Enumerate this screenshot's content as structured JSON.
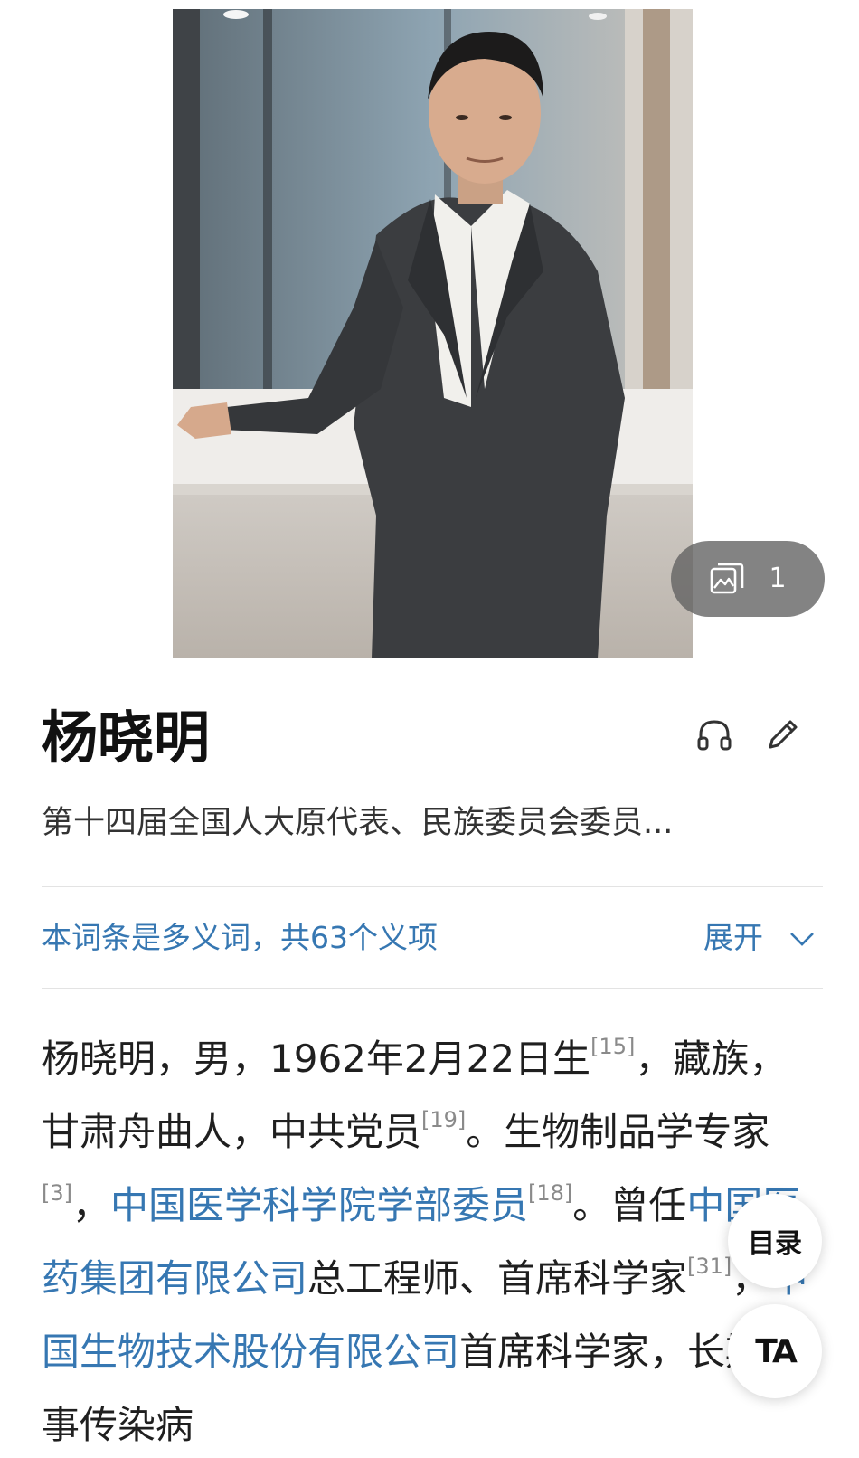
{
  "photo": {
    "gallery_count": "1",
    "gallery_icon": "image-gallery-icon"
  },
  "header": {
    "title": "杨晓明",
    "subtitle": "第十四届全国人大原代表、民族委员会委员...",
    "actions": [
      "headphones-icon",
      "pencil-icon"
    ]
  },
  "polysemy": {
    "note": "本词条是多义词，共63个义项",
    "expand_label": "展开",
    "expand_icon": "chevron-down-icon"
  },
  "body": {
    "segments": [
      {
        "type": "text",
        "text": "杨晓明，男，1962年2月22日生"
      },
      {
        "type": "ref",
        "text": "[15]"
      },
      {
        "type": "text",
        "text": "，藏族，甘肃舟曲人，中共党员"
      },
      {
        "type": "ref",
        "text": "[19]"
      },
      {
        "type": "text",
        "text": "。生物制品学专家"
      },
      {
        "type": "ref",
        "text": "[3]"
      },
      {
        "type": "text",
        "text": "，"
      },
      {
        "type": "link",
        "text": "中国医学科学院学部委员"
      },
      {
        "type": "ref",
        "text": "[18]"
      },
      {
        "type": "text",
        "text": "。曾任"
      },
      {
        "type": "link",
        "text": "中国医药集团有限公司"
      },
      {
        "type": "text",
        "text": "总工程师、首席科学家"
      },
      {
        "type": "ref",
        "text": "[31]"
      },
      {
        "type": "text",
        "text": "，"
      },
      {
        "type": "link",
        "text": "中国生物技术股份有限公司"
      },
      {
        "type": "text",
        "text": "首席科学家，长期从事传染病"
      }
    ]
  },
  "fab": {
    "toc_label": "目录",
    "font_label": "TA"
  },
  "colors": {
    "link": "#3677b2",
    "text": "#1f1f1f",
    "ref": "#8a8a8a"
  }
}
